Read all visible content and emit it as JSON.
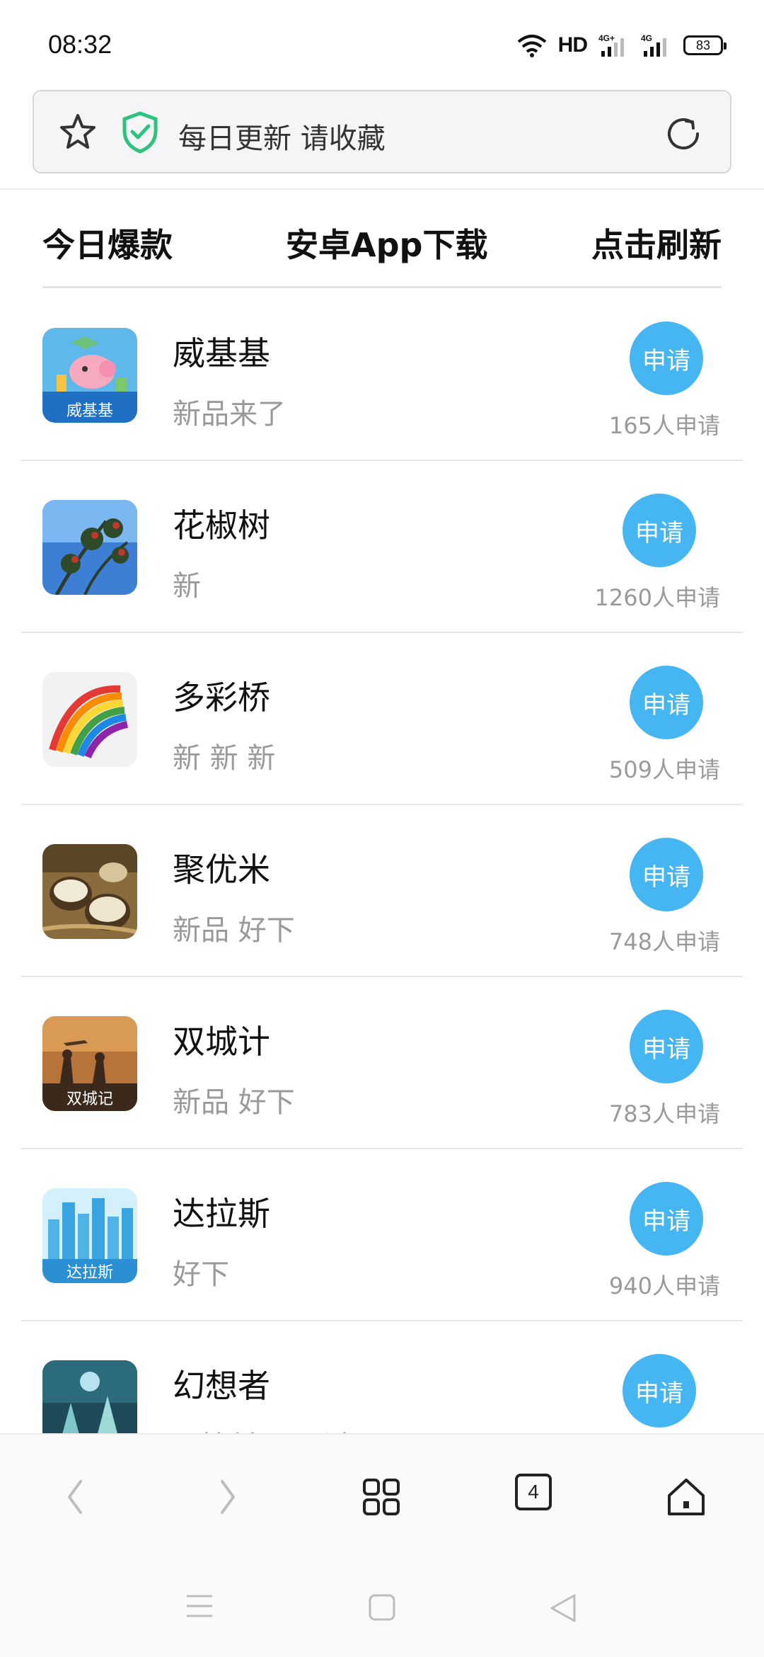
{
  "status_bar": {
    "time": "08:32",
    "hd": "HD",
    "signal1_label": "4G+",
    "signal2_label": "4G",
    "battery": "83"
  },
  "address_bar": {
    "text": "每日更新 请收藏",
    "icons": [
      "star-icon",
      "shield-icon",
      "refresh-icon"
    ]
  },
  "tabs": {
    "left": "今日爆款",
    "center": "安卓App下载",
    "right": "点击刷新"
  },
  "apps": [
    {
      "name": "威基基",
      "desc": "新品来了",
      "button": "申请",
      "count": "165人申请",
      "icon_label": "威基基"
    },
    {
      "name": "花椒树",
      "desc": "新",
      "button": "申请",
      "count": "1260人申请",
      "icon_label": ""
    },
    {
      "name": "多彩桥",
      "desc": "新 新 新",
      "button": "申请",
      "count": "509人申请",
      "icon_label": ""
    },
    {
      "name": "聚优米",
      "desc": "新品 好下",
      "button": "申请",
      "count": "748人申请",
      "icon_label": ""
    },
    {
      "name": "双城计",
      "desc": "新品 好下",
      "button": "申请",
      "count": "783人申请",
      "icon_label": "双城记"
    },
    {
      "name": "达拉斯",
      "desc": "好下",
      "button": "申请",
      "count": "940人申请",
      "icon_label": "达拉斯"
    },
    {
      "name": "幻想者",
      "desc": "风控低 易通过",
      "button": "申请",
      "count": "",
      "icon_label": ""
    }
  ],
  "toolbar": {
    "tab_count": "4",
    "icons": [
      "back-icon",
      "forward-icon",
      "menu-grid-icon",
      "tabs-icon",
      "home-icon"
    ]
  },
  "system_nav": {
    "icons": [
      "recents-icon",
      "home-square-icon",
      "back-triangle-icon"
    ]
  },
  "colors": {
    "accent": "#45b6f2",
    "shield": "#2ec27e",
    "muted_text": "#9a9a9a"
  }
}
